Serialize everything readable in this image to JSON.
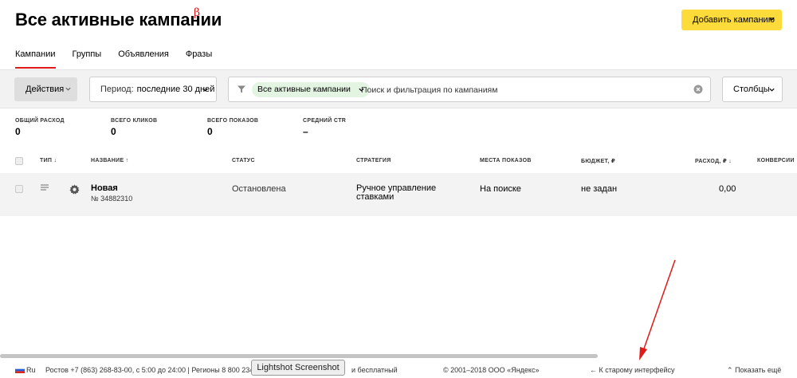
{
  "header": {
    "title": "Все активные кампании",
    "beta": "β",
    "add_button": "Добавить кампанию"
  },
  "tabs": [
    {
      "label": "Кампании",
      "active": true
    },
    {
      "label": "Группы",
      "active": false
    },
    {
      "label": "Объявления",
      "active": false
    },
    {
      "label": "Фразы",
      "active": false
    }
  ],
  "toolbar": {
    "actions": "Действия",
    "period_label": "Период:",
    "period_value": "последние 30 дней",
    "filter_chip": "Все активные кампании",
    "search_placeholder": "Поиск и фильтрация по кампаниям",
    "columns": "Столбцы"
  },
  "stats": [
    {
      "label": "ОБЩИЙ РАСХОД",
      "value": "0"
    },
    {
      "label": "ВСЕГО КЛИКОВ",
      "value": "0"
    },
    {
      "label": "ВСЕГО ПОКАЗОВ",
      "value": "0"
    },
    {
      "label": "СРЕДНИЙ CTR",
      "value": "–"
    }
  ],
  "table": {
    "headers": {
      "type": "ТИП",
      "name": "НАЗВАНИЕ",
      "status": "СТАТУС",
      "strategy": "СТРАТЕГИЯ",
      "places": "МЕСТА ПОКАЗОВ",
      "budget": "БЮДЖЕТ, ₽",
      "spend": "РАСХОД, ₽",
      "conversions": "КОНВЕРСИИ"
    },
    "rows": [
      {
        "name": "Новая",
        "id": "№ 34882310",
        "status": "Остановлена",
        "strategy": "Ручное управление ставками",
        "places": "На поиске",
        "budget": "не задан",
        "spend": "0,00"
      }
    ]
  },
  "footer": {
    "lang": "Ru",
    "phones": "Ростов +7 (863) 268-83-00, с 5:00 до 24:00 | Регионы 8 800 234-24-",
    "free": "и бесплатный",
    "copyright": "© 2001–2018 ООО «Яндекс»",
    "old_interface": "К старому интерфейсу",
    "show_more": "Показать ещё"
  },
  "overlay": {
    "lightshot": "Lightshot Screenshot"
  },
  "colors": {
    "accent_red": "#e01919",
    "add_button_yellow": "#fddb3a",
    "chip_green": "#e4f4e2"
  }
}
